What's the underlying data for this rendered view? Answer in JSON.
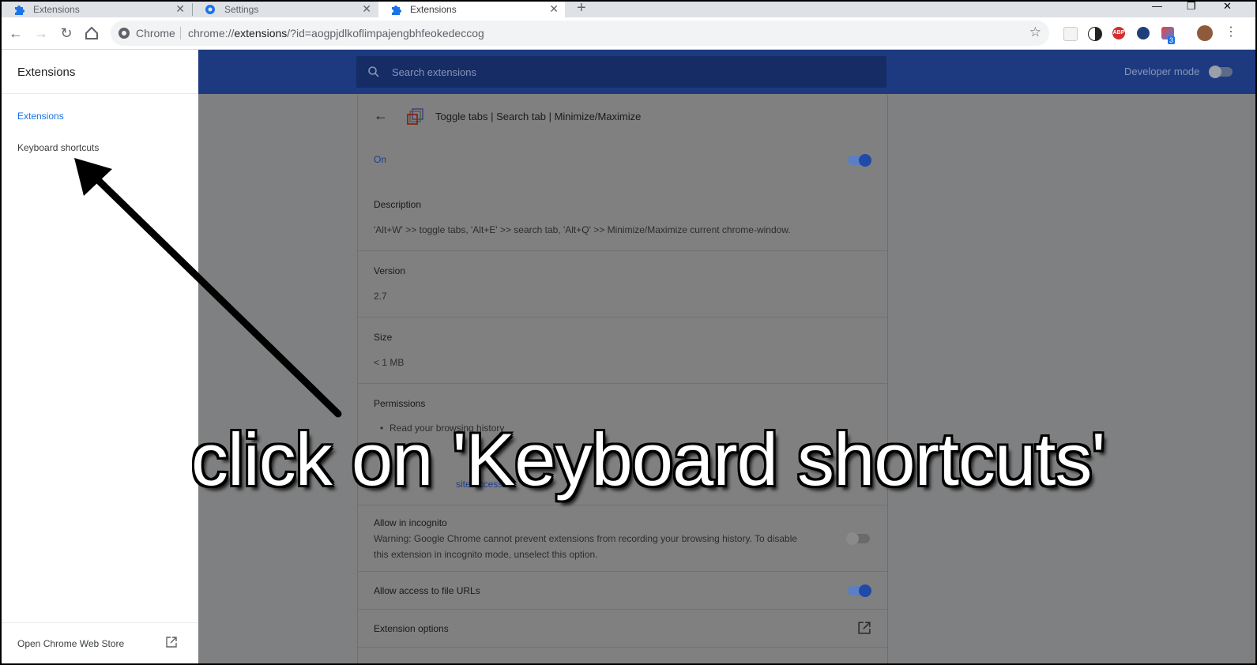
{
  "tabs": [
    {
      "label": "Extensions",
      "icon": "puzzle-icon",
      "active": false
    },
    {
      "label": "Settings",
      "icon": "gear-icon",
      "active": false
    },
    {
      "label": "Extensions",
      "icon": "puzzle-icon",
      "active": true
    }
  ],
  "toolbar": {
    "chip": "Chrome",
    "url_prefix": "chrome://",
    "url_host": "extensions",
    "url_rest": "/?id=aogpjdlkoflimpajengbhfeokedeccog",
    "extension_badge": "3"
  },
  "sidebar": {
    "title": "Extensions",
    "items": [
      {
        "label": "Extensions"
      },
      {
        "label": "Keyboard shortcuts"
      }
    ],
    "store_link": "Open Chrome Web Store"
  },
  "header": {
    "search_placeholder": "Search extensions",
    "developer_mode": "Developer mode"
  },
  "detail": {
    "name": "Toggle tabs | Search tab | Minimize/Maximize",
    "on_label": "On",
    "description_label": "Description",
    "description": "'Alt+W' >> toggle tabs, 'Alt+E' >> search tab, 'Alt+Q' >> Minimize/Maximize current chrome-window.",
    "version_label": "Version",
    "version": "2.7",
    "size_label": "Size",
    "size": "< 1 MB",
    "permissions_label": "Permissions",
    "permission_1": "Read your browsing history",
    "site_access_fragment": "site access",
    "incognito_label": "Allow in incognito",
    "incognito_warning_1": "Warning: Google Chrome cannot prevent extensions from recording your browsing history. To disable",
    "incognito_warning_2": "this extension in incognito mode, unselect this option.",
    "file_urls_label": "Allow access to file URLs",
    "options_label": "Extension options"
  },
  "annotation": {
    "caption": "click on 'Keyboard shortcuts'"
  },
  "colors": {
    "header": "#1d3a80",
    "accent": "#1a73e8",
    "overlay": "#7f8081"
  }
}
